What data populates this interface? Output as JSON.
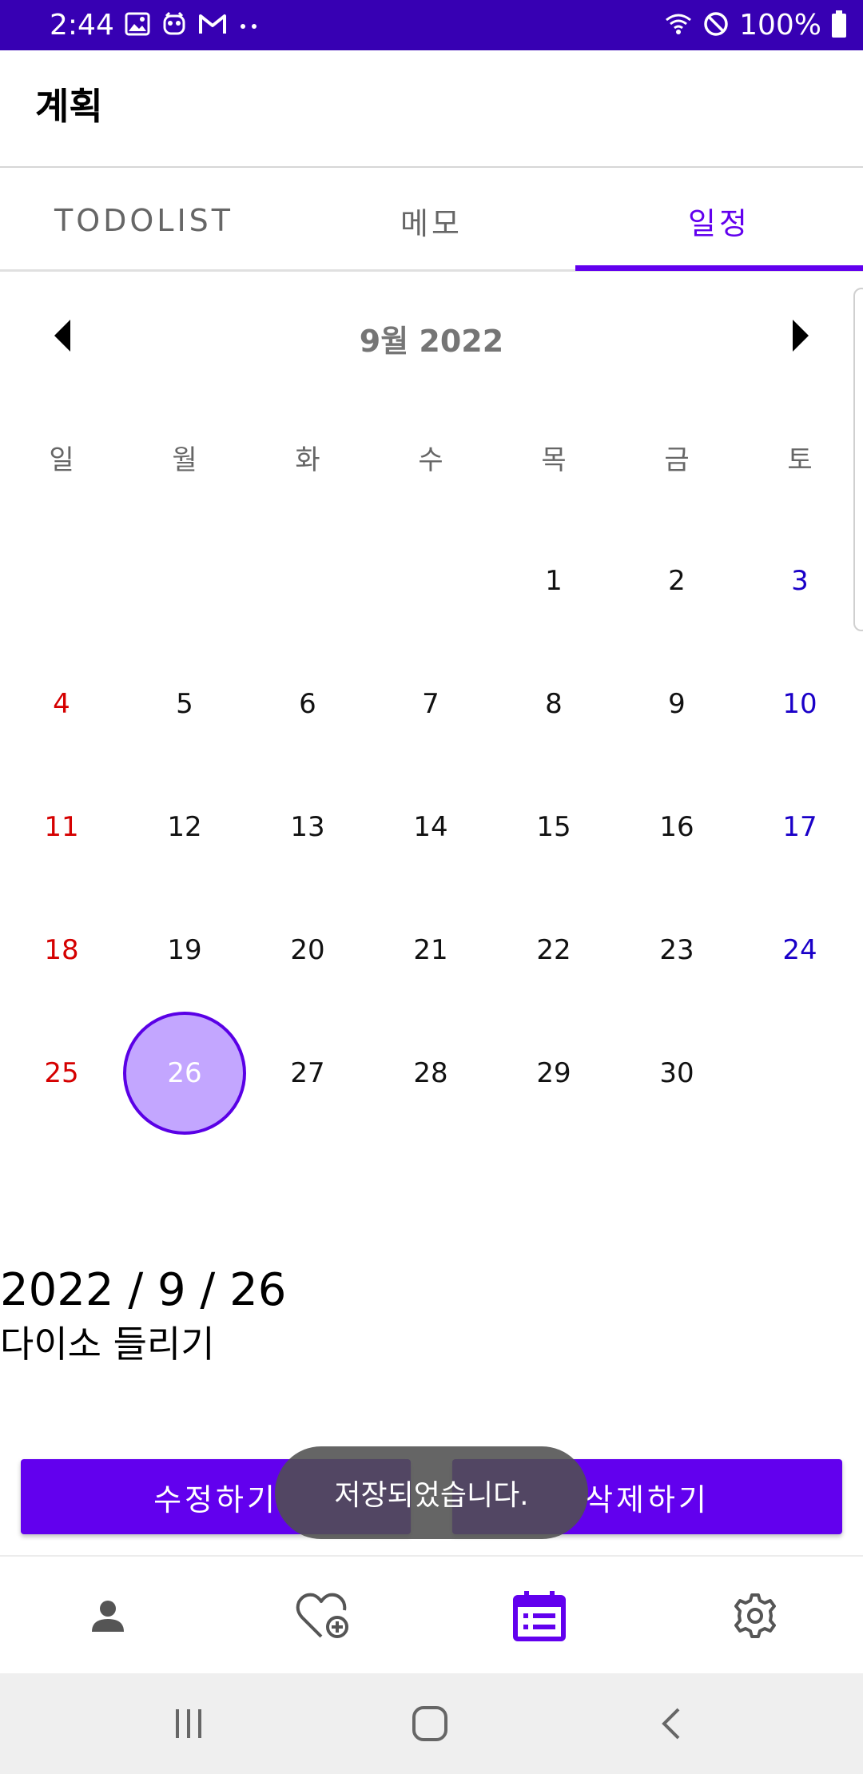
{
  "status_bar": {
    "time": "2:44",
    "battery": "100%",
    "left_icons": [
      "image-icon",
      "owl-icon",
      "gmail-icon",
      "more-dots-icon"
    ],
    "right_icons": [
      "wifi-icon",
      "do-not-disturb-icon",
      "battery-icon"
    ]
  },
  "app_bar": {
    "title": "계획"
  },
  "tabs": [
    {
      "label": "TODOLIST",
      "active": false
    },
    {
      "label": "메모",
      "active": false
    },
    {
      "label": "일정",
      "active": true
    }
  ],
  "calendar": {
    "month_label": "9월 2022",
    "weekdays": [
      "일",
      "월",
      "화",
      "수",
      "목",
      "금",
      "토"
    ],
    "weeks": [
      [
        "",
        "",
        "",
        "",
        "1",
        "2",
        "3"
      ],
      [
        "4",
        "5",
        "6",
        "7",
        "8",
        "9",
        "10"
      ],
      [
        "11",
        "12",
        "13",
        "14",
        "15",
        "16",
        "17"
      ],
      [
        "18",
        "19",
        "20",
        "21",
        "22",
        "23",
        "24"
      ],
      [
        "25",
        "26",
        "27",
        "28",
        "29",
        "30",
        ""
      ]
    ],
    "selected_day": "26",
    "colors": {
      "sunday": "#d50000",
      "saturday": "#1a00c8",
      "selected_fill": "#c3a6ff",
      "selected_border": "#5a00e6"
    }
  },
  "detail": {
    "date": "2022 / 9 / 26",
    "text": "다이소 들리기"
  },
  "actions": {
    "edit_label": "수정하기",
    "delete_label": "삭제하기"
  },
  "toast": {
    "message": "저장되었습니다."
  },
  "bottom_nav": [
    {
      "icon": "person-icon",
      "active": false
    },
    {
      "icon": "heart-plus-icon",
      "active": false
    },
    {
      "icon": "calendar-list-icon",
      "active": true
    },
    {
      "icon": "gear-icon",
      "active": false
    }
  ],
  "theme": {
    "primary": "#6200ee",
    "status_bar": "#3700b3"
  }
}
